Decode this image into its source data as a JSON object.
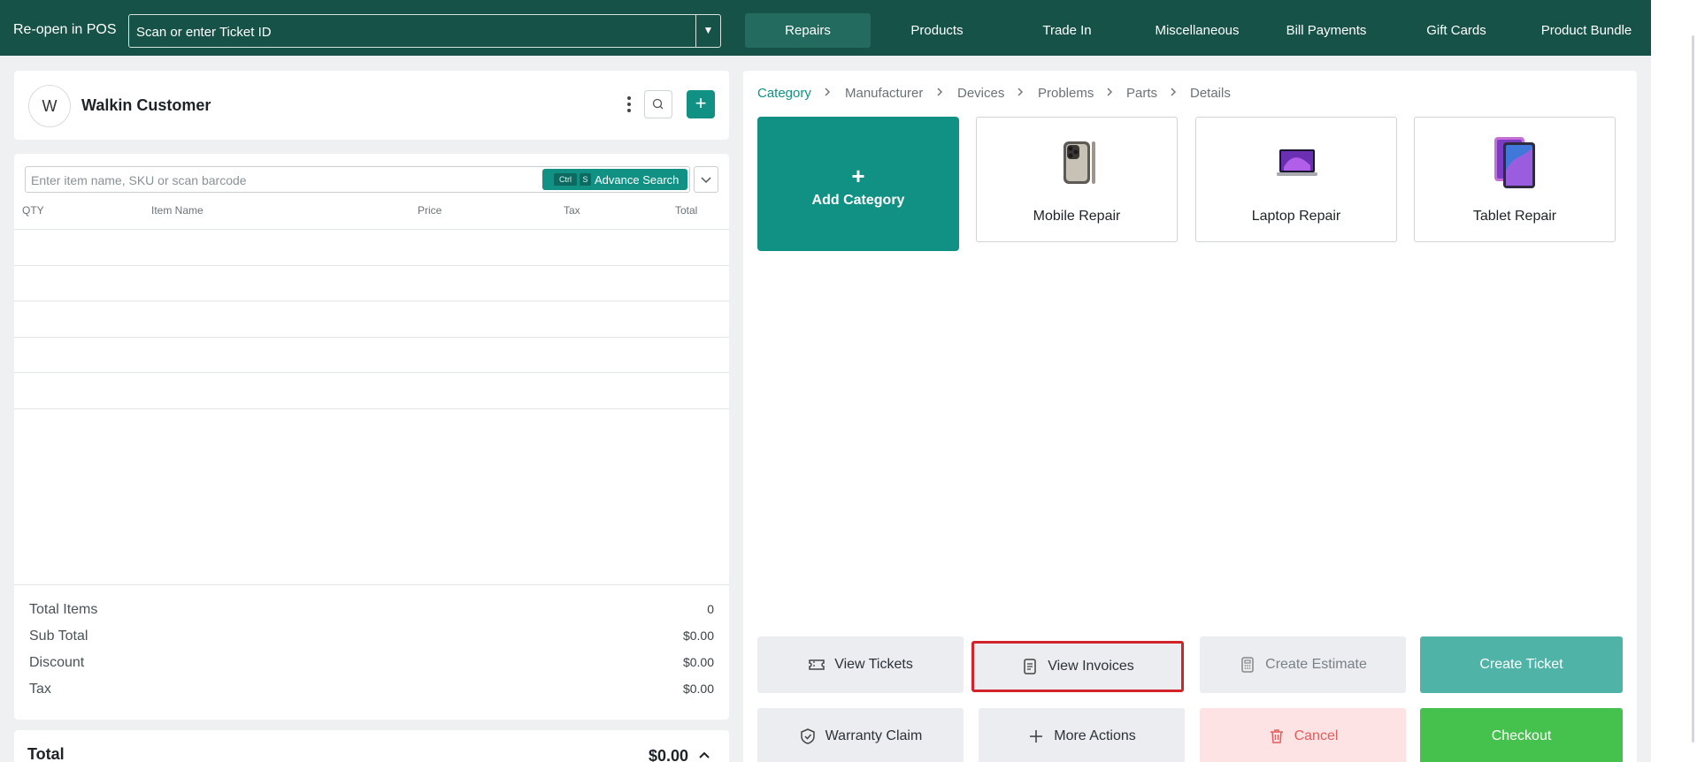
{
  "topbar": {
    "reopen_label": "Re-open in POS",
    "ticket_placeholder": "Scan or enter Ticket ID",
    "tabs": [
      {
        "label": "Repairs",
        "active": true
      },
      {
        "label": "Products",
        "active": false
      },
      {
        "label": "Trade In",
        "active": false
      },
      {
        "label": "Miscellaneous",
        "active": false
      },
      {
        "label": "Bill Payments",
        "active": false
      },
      {
        "label": "Gift Cards",
        "active": false
      },
      {
        "label": "Product Bundle",
        "active": false
      }
    ]
  },
  "customer": {
    "initial": "W",
    "name": "Walkin Customer"
  },
  "cart": {
    "search_placeholder": "Enter item name, SKU or scan barcode",
    "kbd_ctrl": "Ctrl",
    "kbd_key": "S",
    "advance_search_label": "Advance Search",
    "columns": [
      "QTY",
      "Item Name",
      "Price",
      "Tax",
      "Total"
    ]
  },
  "summary": {
    "rows": [
      {
        "label": "Total Items",
        "value": "0"
      },
      {
        "label": "Sub Total",
        "value": "$0.00"
      },
      {
        "label": "Discount",
        "value": "$0.00"
      },
      {
        "label": "Tax",
        "value": "$0.00"
      }
    ],
    "total_label": "Total",
    "total_value": "$0.00"
  },
  "breadcrumb": [
    "Category",
    "Manufacturer",
    "Devices",
    "Problems",
    "Parts",
    "Details"
  ],
  "categories": {
    "add_label": "Add Category",
    "tiles": [
      {
        "label": "Mobile Repair",
        "icon": "phone-device-icon"
      },
      {
        "label": "Laptop Repair",
        "icon": "laptop-device-icon"
      },
      {
        "label": "Tablet Repair",
        "icon": "tablet-device-icon"
      }
    ]
  },
  "actions": {
    "view_tickets": "View Tickets",
    "view_invoices": "View Invoices",
    "create_estimate": "Create Estimate",
    "create_ticket": "Create Ticket",
    "warranty_claim": "Warranty Claim",
    "more_actions": "More Actions",
    "cancel": "Cancel",
    "checkout": "Checkout"
  },
  "colors": {
    "header_bg": "#165247",
    "accent": "#119183",
    "create_ticket_bg": "#4fb3a8",
    "checkout_bg": "#45c24d",
    "cancel_bg": "#fde3e3",
    "cancel_text": "#e35d5d",
    "highlight_border": "#d3232a"
  }
}
